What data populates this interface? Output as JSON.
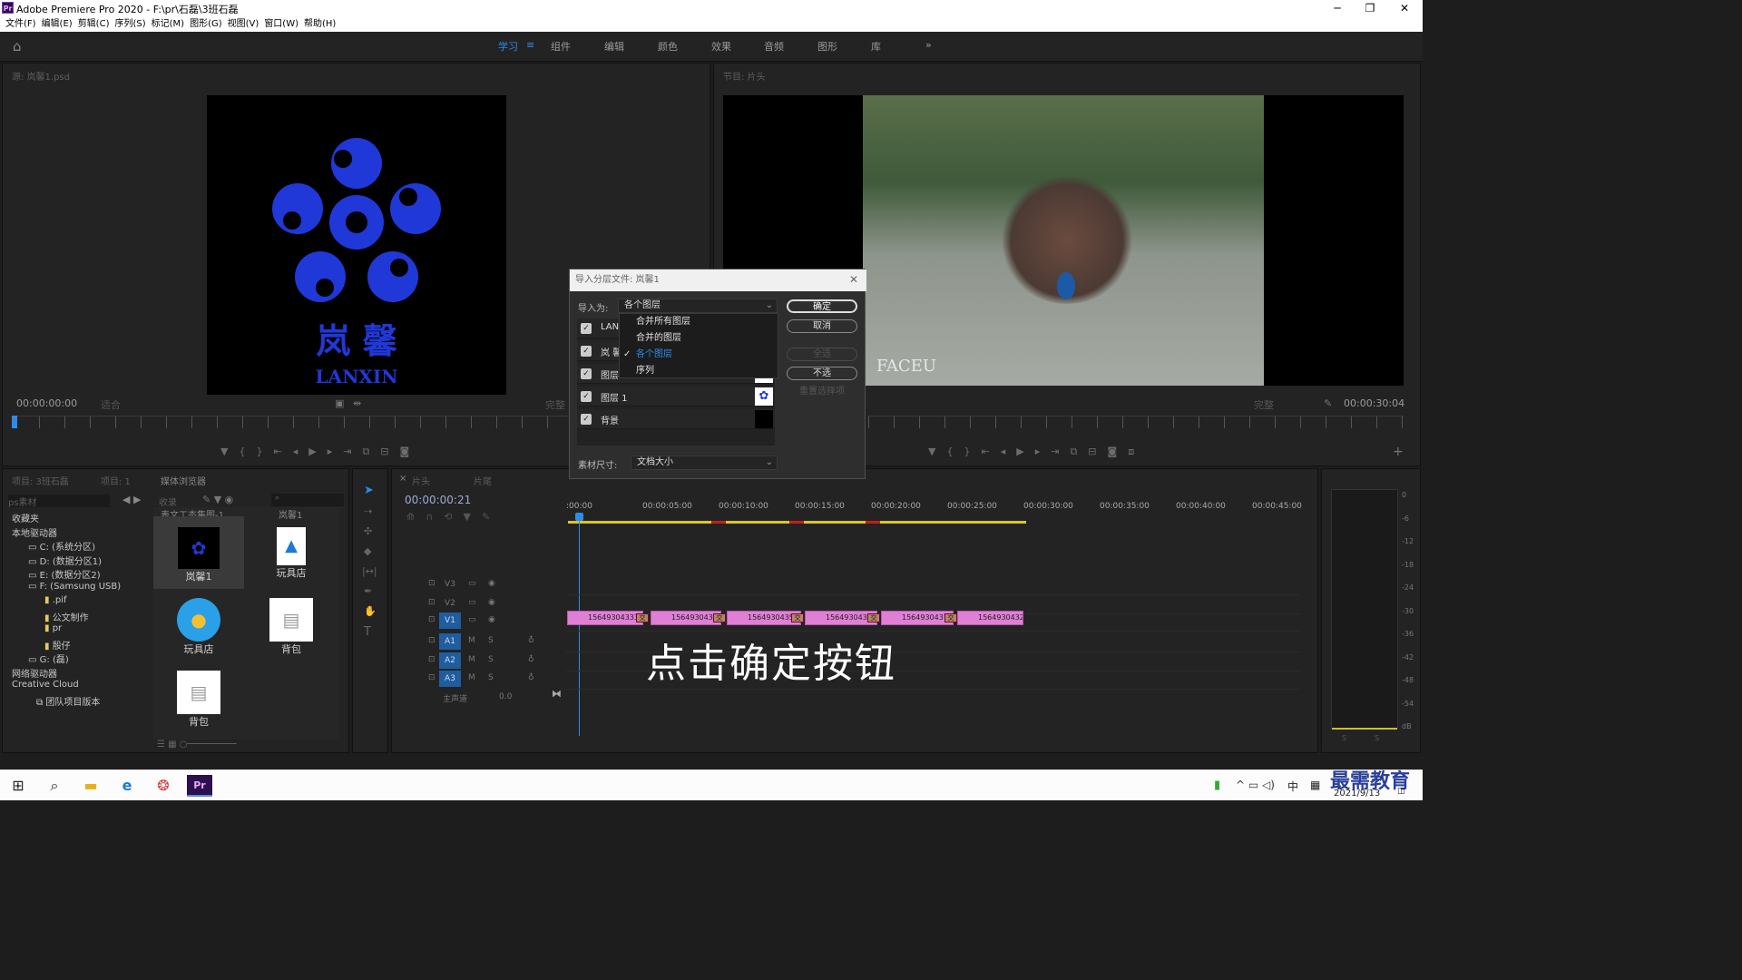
{
  "window": {
    "title": "Adobe Premiere Pro 2020 - F:\\pr\\石磊\\3班石磊",
    "app_icon": "Pr"
  },
  "menu": [
    "文件(F)",
    "编辑(E)",
    "剪辑(C)",
    "序列(S)",
    "标记(M)",
    "图形(G)",
    "视图(V)",
    "窗口(W)",
    "帮助(H)"
  ],
  "workspaces": [
    "学习",
    "组件",
    "编辑",
    "颜色",
    "效果",
    "音频",
    "图形",
    "库"
  ],
  "source": {
    "title": "源: 岚馨1.psd",
    "timecode": "00:00:00:00",
    "fit": "适合",
    "quality": "完整",
    "logo_text": "岚 馨",
    "logo_sub": "LANXIN"
  },
  "program": {
    "title": "节目: 片头",
    "timecode": "00:00:30:04",
    "quality": "完整",
    "watermark": "FACEU"
  },
  "project": {
    "tabs": [
      "项目: 3班石磊",
      "项目: 1",
      "媒体浏览器"
    ],
    "search_label": "ps素材",
    "ingest": "收录",
    "tree": [
      {
        "label": "收藏夹",
        "indent": 0
      },
      {
        "label": "本地驱动器",
        "indent": 0
      },
      {
        "label": "C: (系统分区)",
        "indent": 2
      },
      {
        "label": "D: (数据分区1)",
        "indent": 2
      },
      {
        "label": "E: (数据分区2)",
        "indent": 2
      },
      {
        "label": "F: (Samsung USB)",
        "indent": 2
      },
      {
        "label": ".pif",
        "indent": 4
      },
      {
        "label": "公文制作",
        "indent": 4
      },
      {
        "label": "pr",
        "indent": 4
      },
      {
        "label": "殷仔",
        "indent": 4
      },
      {
        "label": "G: (磊)",
        "indent": 2
      },
      {
        "label": "网络驱动器",
        "indent": 0
      },
      {
        "label": "Creative Cloud",
        "indent": 0
      },
      {
        "label": "团队项目版本",
        "indent": 3
      }
    ],
    "thumbs_top": [
      "表文工态集图-1",
      "岚馨1"
    ],
    "thumbs": [
      "岚馨1",
      "玩具店",
      "玩具店",
      "背包",
      "背包"
    ]
  },
  "timeline": {
    "tabs": [
      "片头",
      "片尾"
    ],
    "timecode": "00:00:00:21",
    "ticks": [
      ":00:00",
      "00:00:05:00",
      "00:00:10:00",
      "00:00:15:00",
      "00:00:20:00",
      "00:00:25:00",
      "00:00:30:00",
      "00:00:35:00",
      "00:00:40:00",
      "00:00:45:00"
    ],
    "tracks": [
      "V3",
      "V2",
      "V1",
      "A1",
      "A2",
      "A3"
    ],
    "master": "主声道",
    "master_val": "0.0",
    "clips": [
      "1564930433351",
      "1564930434",
      "1564930435S",
      "1564930436",
      "1564930437",
      "1564930432B"
    ],
    "fx_label": "交",
    "annotation": "点击确定按钮"
  },
  "meter": {
    "scale": [
      "0",
      "-6",
      "-12",
      "-18",
      "-24",
      "-30",
      "-36",
      "-42",
      "-48",
      "-54",
      "dB"
    ],
    "solo": [
      "S",
      "S"
    ]
  },
  "dialog": {
    "title": "导入分层文件: 岚馨1",
    "import_as_label": "导入为:",
    "import_as_value": "各个图层",
    "options": [
      "合并所有图层",
      "合并的图层",
      "各个图层",
      "序列"
    ],
    "selected_index": 2,
    "layers": [
      "LAN",
      "岚 馨",
      "图层",
      "图层 1",
      "背景"
    ],
    "size_label": "素材尺寸:",
    "size_value": "文档大小",
    "buttons": {
      "ok": "确定",
      "cancel": "取消",
      "select_all": "全选",
      "select_none": "不选",
      "reset": "重置选择项"
    }
  },
  "taskbar": {
    "date": "2021/9/13",
    "ime": "中",
    "brand": "最需教育"
  },
  "colors": {
    "accent": "#2d8ceb",
    "clip": "#e07fd6",
    "logo": "#2038d8"
  }
}
